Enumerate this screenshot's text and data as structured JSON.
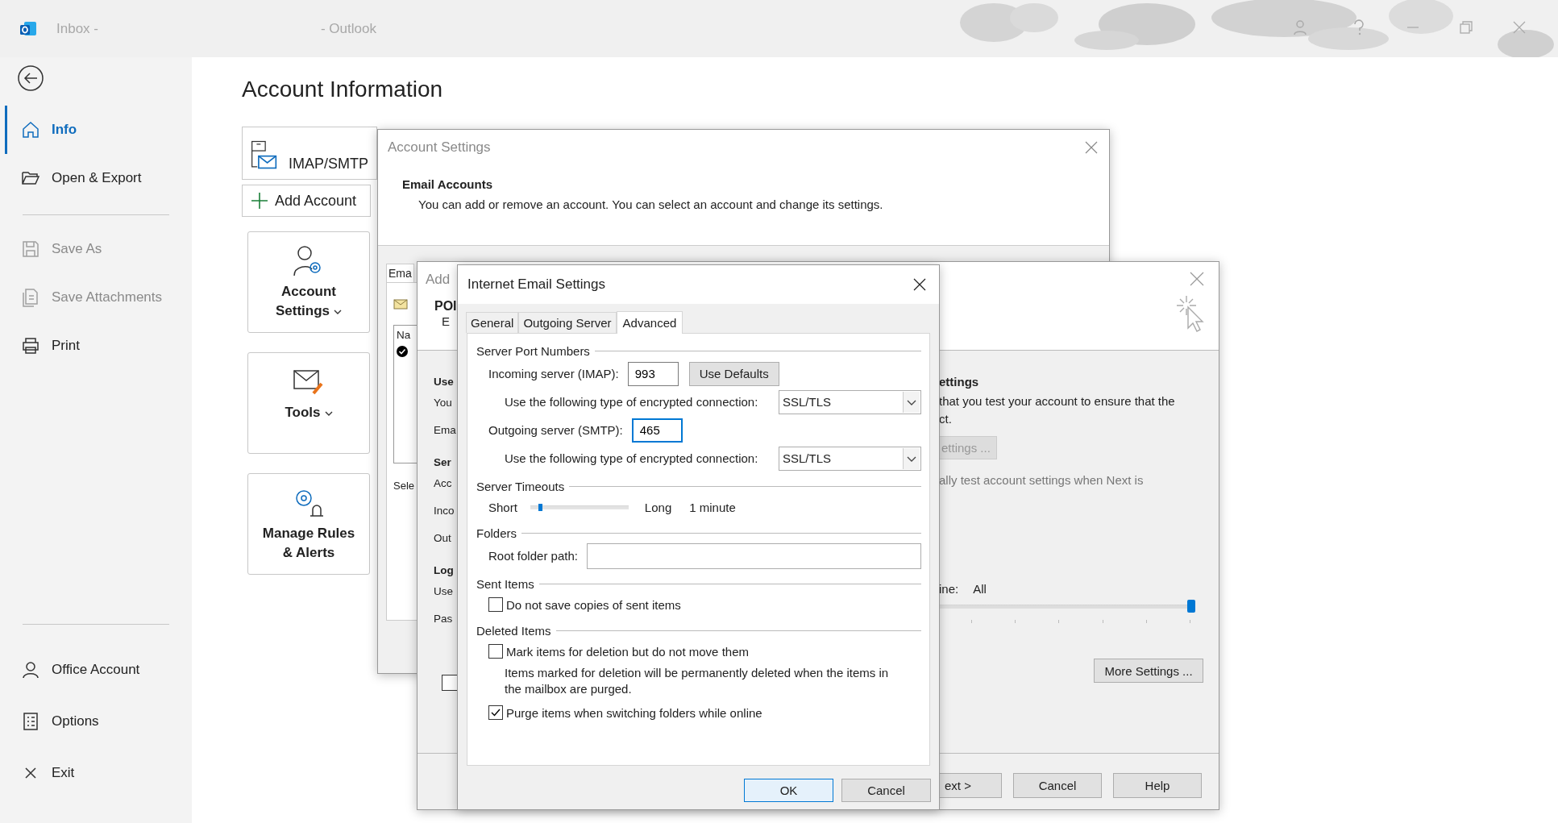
{
  "title_bar": {
    "title_left": "Inbox -",
    "title_right": "- Outlook"
  },
  "sidebar": {
    "groups": [
      {
        "items": [
          {
            "label": "Info",
            "selected": true,
            "disabled": false
          },
          {
            "label": "Open & Export",
            "selected": false,
            "disabled": false
          }
        ]
      },
      {
        "items": [
          {
            "label": "Save As",
            "selected": false,
            "disabled": true
          },
          {
            "label": "Save Attachments",
            "selected": false,
            "disabled": true
          },
          {
            "label": "Print",
            "selected": false,
            "disabled": false
          }
        ]
      },
      {
        "items": [
          {
            "label": "Office Account",
            "selected": false,
            "disabled": false
          },
          {
            "label": "Options",
            "selected": false,
            "disabled": false
          },
          {
            "label": "Exit",
            "selected": false,
            "disabled": false
          }
        ]
      }
    ]
  },
  "main": {
    "heading": "Account Information",
    "account_card": {
      "label": "IMAP/SMTP"
    },
    "add_account_button": "Add Account",
    "tiles": [
      {
        "label": "Account Settings",
        "dropdown": true
      },
      {
        "label": "Tools",
        "dropdown": true
      },
      {
        "label": "Manage Rules & Alerts",
        "dropdown": false
      }
    ]
  },
  "account_settings_dialog": {
    "title": "Account Settings",
    "heading": "Email Accounts",
    "description": "You can add or remove an account. You can select an account and change its settings.",
    "tab_label": "Ema",
    "list_header": "Na",
    "footer_text": "Sele"
  },
  "add_account_dialog": {
    "title": "Add",
    "header_title": "POI",
    "header_subtitle": "E",
    "left_lines": [
      {
        "text": "Use",
        "bold": true
      },
      {
        "text": "You",
        "bold": false
      },
      {
        "text": "Ema",
        "bold": false
      },
      {
        "text": "Ser",
        "bold": true
      },
      {
        "text": "Acc",
        "bold": false
      },
      {
        "text": "Inco",
        "bold": false
      },
      {
        "text": "Out",
        "bold": false
      },
      {
        "text": "Log",
        "bold": true
      },
      {
        "text": "Use",
        "bold": false
      },
      {
        "text": "Pas",
        "bold": false
      }
    ],
    "checkbox": {
      "checked": false
    },
    "right": {
      "heading": "ettings",
      "lines": [
        "that you test your account to ensure that the",
        "ct."
      ],
      "disabled_button": "ettings ...",
      "auto_test_text": "ally test account settings when Next is",
      "mail_slider": {
        "label": "ine:",
        "value": "All",
        "level": 1
      },
      "more_settings_button": "More Settings ...",
      "footer_buttons": [
        "ext >",
        "Cancel",
        "Help"
      ]
    }
  },
  "internet_email_settings": {
    "title": "Internet Email Settings",
    "tabs": [
      {
        "label": "General",
        "selected": false
      },
      {
        "label": "Outgoing Server",
        "selected": false
      },
      {
        "label": "Advanced",
        "selected": true
      }
    ],
    "sections": [
      {
        "title": "Server Port Numbers",
        "rows": [
          {
            "kind": "port",
            "label": "Incoming server (IMAP):",
            "value": "993",
            "focused": false,
            "button": "Use Defaults"
          },
          {
            "kind": "select",
            "label": "Use the following type of encrypted connection:",
            "value": "SSL/TLS"
          },
          {
            "kind": "port",
            "label": "Outgoing server (SMTP):",
            "value": "465",
            "focused": true
          },
          {
            "kind": "select",
            "label": "Use the following type of encrypted connection:",
            "value": "SSL/TLS"
          }
        ]
      },
      {
        "title": "Server Timeouts",
        "rows": [
          {
            "kind": "slider",
            "min_label": "Short",
            "max_label": "Long",
            "level": 0.09,
            "reading": "1 minute"
          }
        ]
      },
      {
        "title": "Folders",
        "rows": [
          {
            "kind": "text_field",
            "label": "Root folder path:"
          }
        ]
      },
      {
        "title": "Sent Items",
        "rows": [
          {
            "kind": "checkbox",
            "label": "Do not save copies of sent items",
            "checked": false
          }
        ]
      },
      {
        "title": "Deleted Items",
        "rows": [
          {
            "kind": "checkbox",
            "label": "Mark items for deletion but do not move them",
            "checked": false
          },
          {
            "kind": "note",
            "text": "Items marked for deletion will be permanently deleted when the items in the mailbox are purged."
          },
          {
            "kind": "checkbox",
            "label": "Purge items when switching folders while online",
            "checked": true
          }
        ]
      }
    ],
    "buttons": [
      {
        "label": "OK",
        "default": true
      },
      {
        "label": "Cancel",
        "default": false
      }
    ]
  }
}
